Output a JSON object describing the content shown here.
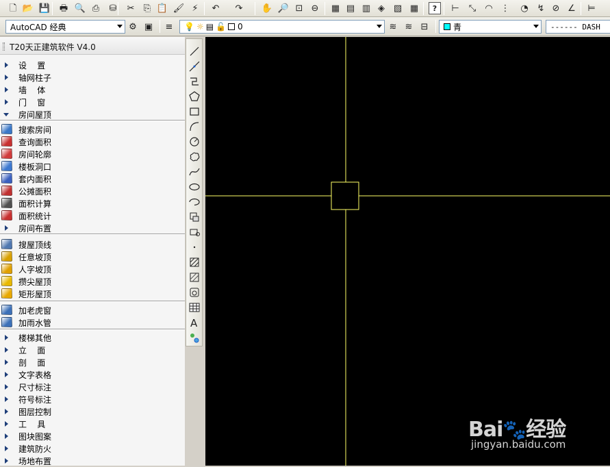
{
  "toolbar_top": {
    "icons": [
      "new-file-icon",
      "open-file-icon",
      "save-icon",
      "print-icon",
      "print-preview-icon",
      "plot-icon",
      "publish-icon",
      "cut-icon",
      "copy-icon",
      "paste-icon",
      "match-properties-icon",
      "block-editor-icon",
      "undo-icon",
      "redo-icon",
      "pan-icon",
      "zoom-realtime-icon",
      "zoom-window-icon",
      "zoom-previous-icon",
      "properties-icon",
      "design-center-icon",
      "tool-palettes-icon",
      "sheet-set-icon",
      "markup-icon",
      "calculator-icon",
      "help-icon",
      "dim-linear-icon",
      "dim-aligned-icon",
      "dim-arc-icon",
      "dim-ordinate-icon",
      "dim-radius-icon",
      "dim-jogged-icon",
      "dim-diameter-icon",
      "dim-angular-icon",
      "dim-quick-icon"
    ]
  },
  "toolbar_second": {
    "workspace": "AutoCAD 经典",
    "layer": "0",
    "color": "青",
    "color_hex": "#00ffff",
    "linetype": "------ DASH"
  },
  "panel": {
    "title": "T20天正建筑软件 V4.0",
    "items": [
      {
        "label": "设    置",
        "kind": "collapsed"
      },
      {
        "label": "轴网柱子",
        "kind": "collapsed"
      },
      {
        "label": "墙    体",
        "kind": "collapsed"
      },
      {
        "label": "门    窗",
        "kind": "collapsed"
      },
      {
        "label": "房间屋顶",
        "kind": "expanded"
      },
      {
        "label": "搜索房间",
        "kind": "command",
        "icon": "search-room-icon",
        "color": "#3a78c8"
      },
      {
        "label": "查询面积",
        "kind": "command",
        "icon": "query-area-icon",
        "color": "#c83030"
      },
      {
        "label": "房间轮廓",
        "kind": "command",
        "icon": "room-outline-icon",
        "color": "#d03c3c"
      },
      {
        "label": "楼板洞口",
        "kind": "command",
        "icon": "floor-opening-icon",
        "color": "#3c78d0"
      },
      {
        "label": "套内面积",
        "kind": "command",
        "icon": "suite-area-icon",
        "color": "#3a60c0"
      },
      {
        "label": "公摊面积",
        "kind": "command",
        "icon": "shared-area-icon",
        "color": "#c03030"
      },
      {
        "label": "面积计算",
        "kind": "command",
        "icon": "area-calc-icon",
        "color": "#505050"
      },
      {
        "label": "面积统计",
        "kind": "command",
        "icon": "area-stats-icon",
        "color": "#c83030"
      },
      {
        "label": "房间布置",
        "kind": "collapsed"
      },
      {
        "label": "搜屋顶线",
        "kind": "command",
        "icon": "roof-line-icon",
        "color": "#5078b0"
      },
      {
        "label": "任意坡顶",
        "kind": "command",
        "icon": "any-slope-roof-icon",
        "color": "#d8a000"
      },
      {
        "label": "人字坡顶",
        "kind": "command",
        "icon": "gable-roof-icon",
        "color": "#e0a000"
      },
      {
        "label": "攒尖屋顶",
        "kind": "command",
        "icon": "pyramid-roof-icon",
        "color": "#e8b800"
      },
      {
        "label": "矩形屋顶",
        "kind": "command",
        "icon": "rect-roof-icon",
        "color": "#e8a800"
      },
      {
        "label": "加老虎窗",
        "kind": "command",
        "icon": "dormer-window-icon",
        "color": "#3c70b8"
      },
      {
        "label": "加雨水管",
        "kind": "command",
        "icon": "rain-pipe-icon",
        "color": "#3c70b8"
      },
      {
        "label": "楼梯其他",
        "kind": "collapsed"
      },
      {
        "label": "立    面",
        "kind": "collapsed"
      },
      {
        "label": "剖    面",
        "kind": "collapsed"
      },
      {
        "label": "文字表格",
        "kind": "collapsed"
      },
      {
        "label": "尺寸标注",
        "kind": "collapsed"
      },
      {
        "label": "符号标注",
        "kind": "collapsed"
      },
      {
        "label": "图层控制",
        "kind": "collapsed"
      },
      {
        "label": "工    具",
        "kind": "collapsed"
      },
      {
        "label": "图块图案",
        "kind": "collapsed"
      },
      {
        "label": "建筑防火",
        "kind": "collapsed"
      },
      {
        "label": "场地布置",
        "kind": "collapsed"
      }
    ]
  },
  "draw_toolbar": {
    "icons": [
      "line-icon",
      "construction-line-icon",
      "polyline-icon",
      "polygon-icon",
      "rectangle-icon",
      "arc-icon",
      "circle-icon",
      "revision-cloud-icon",
      "spline-icon",
      "ellipse-icon",
      "ellipse-arc-icon",
      "insert-block-icon",
      "make-block-icon",
      "point-icon",
      "hatch-icon",
      "gradient-icon",
      "region-icon",
      "table-icon",
      "multiline-text-icon",
      "add-selected-icon"
    ]
  },
  "canvas": {
    "background": "#000000",
    "crosshair_color": "#ffff66"
  },
  "watermark": {
    "main": "Bai",
    "suffix": "经验",
    "url": "jingyan.baidu.com"
  }
}
